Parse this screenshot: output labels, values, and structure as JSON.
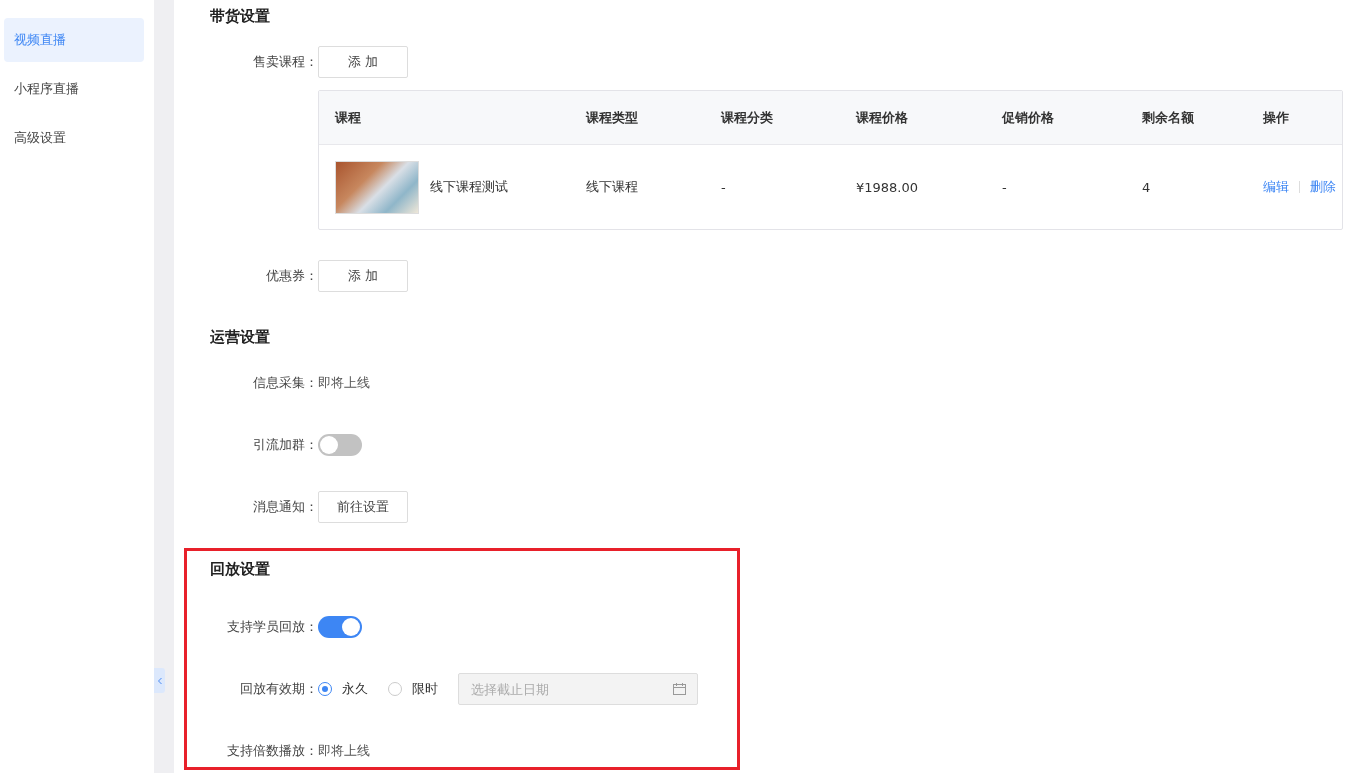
{
  "sidebar": {
    "items": [
      {
        "label": "视频直播",
        "selected": true
      },
      {
        "label": "小程序直播",
        "selected": false
      },
      {
        "label": "高级设置",
        "selected": false
      }
    ]
  },
  "sections": [
    {
      "title": "带货设置",
      "highlighted": false,
      "items": [
        {
          "kind": "button",
          "label": "售卖课程：",
          "button": "添 加"
        },
        {
          "kind": "table",
          "columns": [
            "课程",
            "课程类型",
            "课程分类",
            "课程价格",
            "促销价格",
            "剩余名额",
            "操作"
          ],
          "rows": [
            {
              "course": "线下课程测试",
              "type": "线下课程",
              "category": "-",
              "price": "¥1988.00",
              "promo_price": "-",
              "remaining": "4",
              "actions": [
                "编辑",
                "删除"
              ]
            }
          ]
        },
        {
          "kind": "button",
          "label": "优惠券：",
          "button": "添 加"
        }
      ]
    },
    {
      "title": "运营设置",
      "highlighted": false,
      "items": [
        {
          "kind": "text",
          "label": "信息采集：",
          "value": "即将上线"
        },
        {
          "kind": "switch",
          "label": "引流加群：",
          "on": false
        },
        {
          "kind": "button",
          "label": "消息通知：",
          "button": "前往设置"
        }
      ]
    },
    {
      "title": "回放设置",
      "highlighted": true,
      "items": [
        {
          "kind": "switch",
          "label": "支持学员回放：",
          "on": true
        },
        {
          "kind": "radio",
          "label": "回放有效期：",
          "options": [
            {
              "label": "永久",
              "selected": true
            },
            {
              "label": "限时",
              "selected": false
            }
          ],
          "date_placeholder": "选择截止日期"
        },
        {
          "kind": "text",
          "label": "支持倍数播放：",
          "value": "即将上线"
        }
      ]
    }
  ]
}
